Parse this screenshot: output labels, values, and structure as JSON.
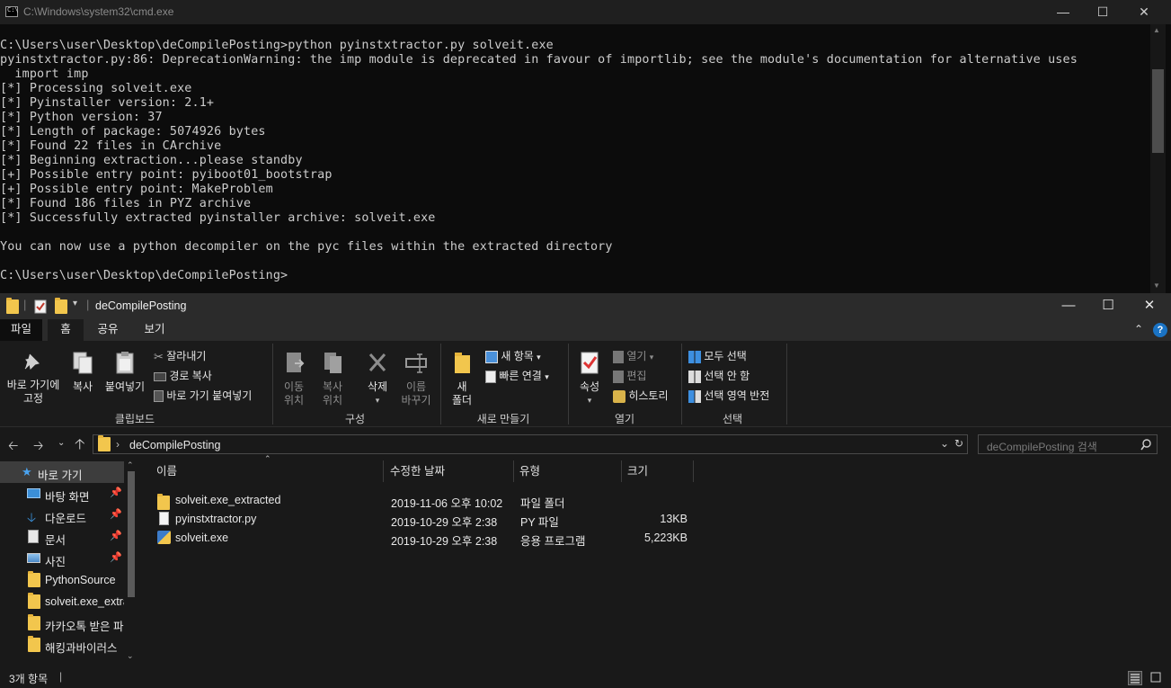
{
  "cmd": {
    "title": "C:\\Windows\\system32\\cmd.exe",
    "icon": "terminal-icon",
    "lines": [
      "C:\\Users\\user\\Desktop\\deCompilePosting>python pyinstxtractor.py solveit.exe",
      "pyinstxtractor.py:86: DeprecationWarning: the imp module is deprecated in favour of importlib; see the module's documentation for alternative uses",
      "  import imp",
      "[*] Processing solveit.exe",
      "[*] Pyinstaller version: 2.1+",
      "[*] Python version: 37",
      "[*] Length of package: 5074926 bytes",
      "[*] Found 22 files in CArchive",
      "[*] Beginning extraction...please standby",
      "[+] Possible entry point: pyiboot01_bootstrap",
      "[+] Possible entry point: MakeProblem",
      "[*] Found 186 files in PYZ archive",
      "[*] Successfully extracted pyinstaller archive: solveit.exe",
      "",
      "You can now use a python decompiler on the pyc files within the extracted directory",
      "",
      "C:\\Users\\user\\Desktop\\deCompilePosting>"
    ]
  },
  "explorer": {
    "title": "deCompilePosting",
    "tabs": {
      "file": "파일",
      "home": "홈",
      "share": "공유",
      "view": "보기"
    },
    "ribbon": {
      "clipboard": {
        "label": "클립보드",
        "pin_quick": "바로 가기에\n고정",
        "copy": "복사",
        "paste": "붙여넣기",
        "cut": "잘라내기",
        "copy_path": "경로 복사",
        "paste_shortcut": "바로 가기 붙여넣기"
      },
      "organize": {
        "label": "구성",
        "move_to": "이동\n위치",
        "copy_to": "복사\n위치",
        "delete": "삭제",
        "rename": "이름\n바꾸기"
      },
      "new": {
        "label": "새로 만들기",
        "new_folder": "새\n폴더",
        "new_item": "새 항목",
        "easy_access": "빠른 연결"
      },
      "open": {
        "label": "열기",
        "properties": "속성",
        "open": "열기",
        "edit": "편집",
        "history": "히스토리"
      },
      "select": {
        "label": "선택",
        "select_all": "모두 선택",
        "select_none": "선택 안 함",
        "invert": "선택 영역 반전"
      }
    },
    "address": {
      "path": "deCompilePosting",
      "search_placeholder": "deCompilePosting 검색"
    },
    "nav": [
      {
        "label": "바로 가기",
        "icon": "star-icon"
      },
      {
        "label": "바탕 화면",
        "icon": "desktop-icon"
      },
      {
        "label": "다운로드",
        "icon": "download-icon"
      },
      {
        "label": "문서",
        "icon": "document-icon"
      },
      {
        "label": "사진",
        "icon": "pictures-icon"
      },
      {
        "label": "PythonSource",
        "icon": "folder-icon"
      },
      {
        "label": "solveit.exe_extra",
        "icon": "folder-icon"
      },
      {
        "label": "카카오톡 받은 파",
        "icon": "folder-icon"
      },
      {
        "label": "해킹과바이러스",
        "icon": "folder-icon"
      }
    ],
    "columns": {
      "name": "이름",
      "modified": "수정한 날짜",
      "type": "유형",
      "size": "크기"
    },
    "files": [
      {
        "name": "solveit.exe_extracted",
        "modified": "2019-11-06 오후 10:02",
        "type": "파일 폴더",
        "size": "",
        "icon": "folder-icon"
      },
      {
        "name": "pyinstxtractor.py",
        "modified": "2019-10-29 오후 2:38",
        "type": "PY 파일",
        "size": "13KB",
        "icon": "file-icon"
      },
      {
        "name": "solveit.exe",
        "modified": "2019-10-29 오후 2:38",
        "type": "응용 프로그램",
        "size": "5,223KB",
        "icon": "exe-icon"
      }
    ],
    "status": "3개 항목"
  },
  "colors": {
    "terminal_bg": "#0c0c0c",
    "terminal_fg": "#cccccc",
    "explorer_bg": "#191919",
    "folder": "#f2c64d",
    "accent_blue": "#1a73c4"
  }
}
